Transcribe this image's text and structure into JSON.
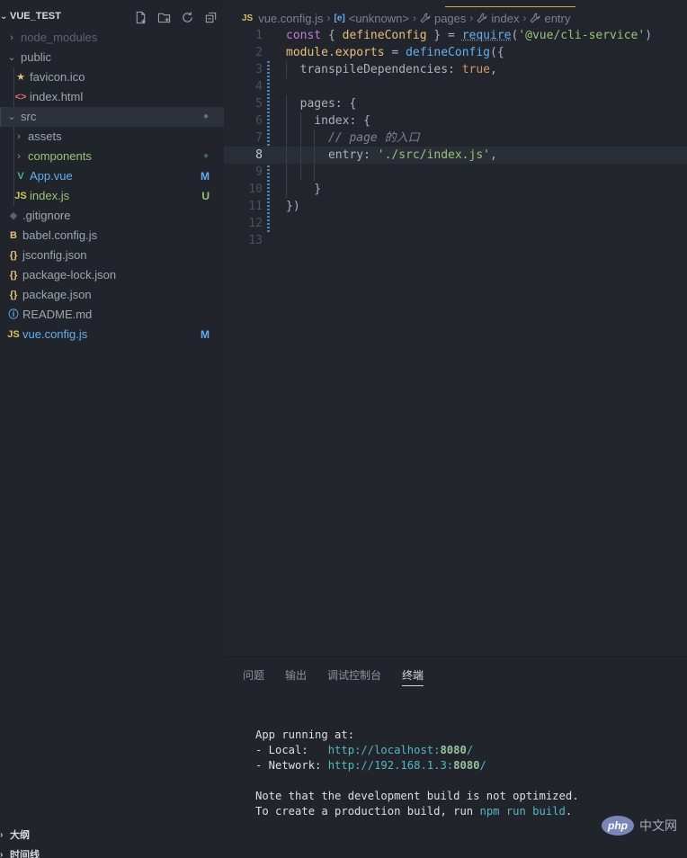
{
  "explorer": {
    "title": "VUE_TEST",
    "actions": [
      "new-file-icon",
      "new-folder-icon",
      "refresh-icon",
      "collapse-all-icon"
    ],
    "items": [
      {
        "label": "node_modules",
        "type": "folder",
        "depth": 0,
        "expanded": false,
        "dimmed": true
      },
      {
        "label": "public",
        "type": "folder",
        "depth": 0,
        "expanded": true
      },
      {
        "label": "favicon.ico",
        "type": "favicon",
        "depth": 1
      },
      {
        "label": "index.html",
        "type": "html",
        "depth": 1
      },
      {
        "label": "src",
        "type": "folder",
        "depth": 0,
        "expanded": true,
        "selected": true,
        "status": "●",
        "status_color": "#6b717c"
      },
      {
        "label": "assets",
        "type": "folder",
        "depth": 1,
        "expanded": false
      },
      {
        "label": "components",
        "type": "folder",
        "depth": 1,
        "expanded": false,
        "color": "#98c379",
        "status": "●",
        "status_color": "#3b6e45"
      },
      {
        "label": "App.vue",
        "type": "vue",
        "depth": 1,
        "color": "#61afef",
        "status": "M",
        "status_color": "#61afef"
      },
      {
        "label": "index.js",
        "type": "js",
        "depth": 1,
        "color": "#98c379",
        "status": "U",
        "status_color": "#98c379"
      },
      {
        "label": ".gitignore",
        "type": "git",
        "depth": 0
      },
      {
        "label": "babel.config.js",
        "type": "babel",
        "depth": 0
      },
      {
        "label": "jsconfig.json",
        "type": "json",
        "depth": 0
      },
      {
        "label": "package-lock.json",
        "type": "json",
        "depth": 0
      },
      {
        "label": "package.json",
        "type": "json",
        "depth": 0
      },
      {
        "label": "README.md",
        "type": "info",
        "depth": 0
      },
      {
        "label": "vue.config.js",
        "type": "js",
        "depth": 0,
        "color": "#61afef",
        "status": "M",
        "status_color": "#61afef"
      }
    ],
    "bottom_sections": [
      "大纲",
      "时间线"
    ]
  },
  "editor": {
    "breadcrumbs": {
      "file_icon": "JS",
      "file": "vue.config.js",
      "symbol_icon": "[e]",
      "items": [
        "<unknown>",
        "pages",
        "index",
        "entry"
      ]
    },
    "current_line": 8,
    "lines": [
      [
        [
          "k",
          "const"
        ],
        [
          "p",
          " { "
        ],
        [
          "v",
          "defineConfig"
        ],
        [
          "p",
          " } = "
        ],
        [
          "f req",
          "require"
        ],
        [
          "p",
          "("
        ],
        [
          "s",
          "'@vue/cli-service'"
        ],
        [
          "p",
          ")"
        ]
      ],
      [
        [
          "v",
          "module"
        ],
        [
          "p",
          "."
        ],
        [
          "v",
          "exports"
        ],
        [
          "p",
          " = "
        ],
        [
          "f",
          "defineConfig"
        ],
        [
          "p",
          "({"
        ]
      ],
      [
        [
          "p",
          "  "
        ],
        [
          "key",
          "transpileDependencies"
        ],
        [
          "p",
          ": "
        ],
        [
          "b",
          "true"
        ],
        [
          "p",
          ","
        ]
      ],
      [],
      [
        [
          "p",
          "  "
        ],
        [
          "key",
          "pages"
        ],
        [
          "p",
          ": {"
        ]
      ],
      [
        [
          "p",
          "    "
        ],
        [
          "key",
          "index"
        ],
        [
          "p",
          ": {"
        ]
      ],
      [
        [
          "p",
          "      "
        ],
        [
          "c",
          "// page 的入口"
        ]
      ],
      [
        [
          "p",
          "      "
        ],
        [
          "key",
          "entry"
        ],
        [
          "p",
          ": "
        ],
        [
          "s",
          "'./src/index.js'"
        ],
        [
          "p",
          ","
        ]
      ],
      [],
      [
        [
          "p",
          "    }"
        ]
      ],
      [
        [
          "p",
          "})"
        ]
      ],
      [],
      []
    ]
  },
  "panel": {
    "tabs": [
      "问题",
      "输出",
      "调试控制台",
      "终端"
    ],
    "active_tab": "终端",
    "terminal": {
      "line1": "App running at:",
      "local_label": "- Local:   ",
      "local_url": "http://localhost:",
      "local_port": "8080",
      "local_slash": "/",
      "network_label": "- Network: ",
      "network_url": "http://192.168.1.3:",
      "network_port": "8080",
      "network_slash": "/",
      "note1": "Note that the development build is not optimized.",
      "note2_pre": "To create a production build, run ",
      "note2_cmd": "npm run build",
      "note2_post": "."
    },
    "watermark_badge": "php",
    "watermark_text": "中文网"
  }
}
